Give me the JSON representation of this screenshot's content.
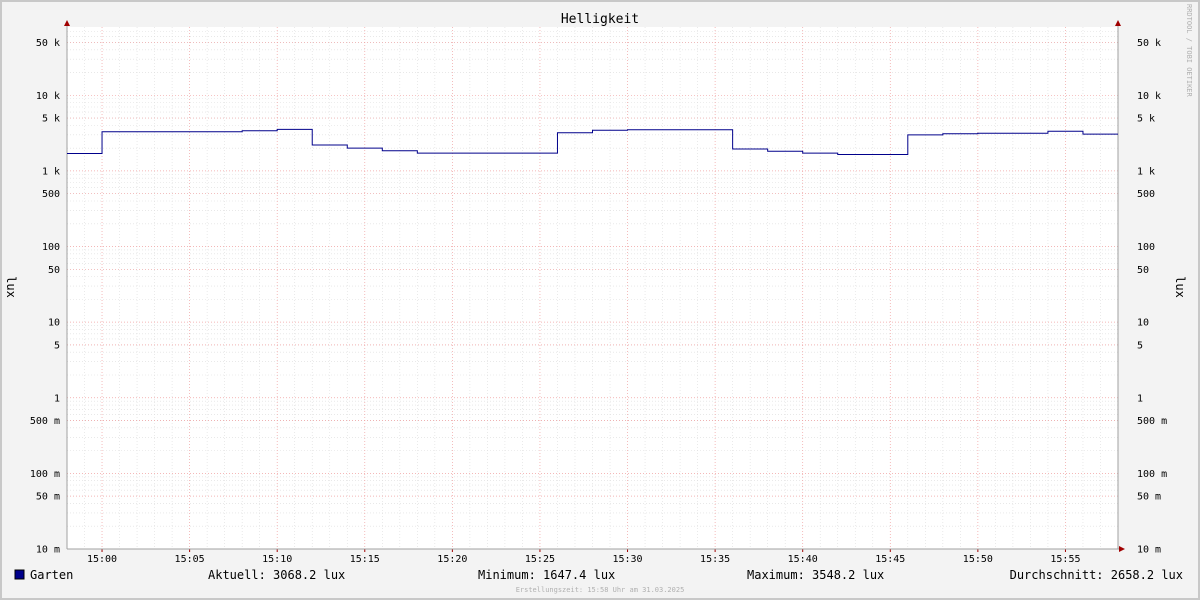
{
  "watermark": "RRDTOOL / TOBI OETIKER",
  "footer": "Erstellungszeit: 15:58 Uhr am 31.03.2025",
  "legend": {
    "series_name": "Garten",
    "current": "Aktuell: 3068.2 lux",
    "minimum": "Minimum: 1647.4 lux",
    "maximum": "Maximum: 3548.2 lux",
    "average": "Durchschnitt: 2658.2 lux"
  },
  "chart_data": {
    "type": "line",
    "title": "Helligkeit",
    "ylabel": "lux",
    "y_scale": "log",
    "ylim": [
      0.01,
      80000
    ],
    "xlim": [
      "14:58",
      "15:58"
    ],
    "grid": true,
    "line_color": "#00008b",
    "legend_color": "#00008b",
    "x_ticks": [
      "15:00",
      "15:05",
      "15:10",
      "15:15",
      "15:20",
      "15:25",
      "15:30",
      "15:35",
      "15:40",
      "15:45",
      "15:50",
      "15:55"
    ],
    "y_ticks": [
      {
        "value": 0.01,
        "label": "10 m"
      },
      {
        "value": 0.05,
        "label": "50 m"
      },
      {
        "value": 0.1,
        "label": "100 m"
      },
      {
        "value": 0.5,
        "label": "500 m"
      },
      {
        "value": 1,
        "label": "1"
      },
      {
        "value": 5,
        "label": "5"
      },
      {
        "value": 10,
        "label": "10"
      },
      {
        "value": 50,
        "label": "50"
      },
      {
        "value": 100,
        "label": "100"
      },
      {
        "value": 500,
        "label": "500"
      },
      {
        "value": 1000,
        "label": "1 k"
      },
      {
        "value": 5000,
        "label": "5 k"
      },
      {
        "value": 10000,
        "label": "10 k"
      },
      {
        "value": 50000,
        "label": "50 k"
      }
    ],
    "series": [
      {
        "name": "Garten",
        "step": true,
        "x": [
          "14:58",
          "15:00",
          "15:08",
          "15:10",
          "15:12",
          "15:14",
          "15:16",
          "15:18",
          "15:26",
          "15:28",
          "15:30",
          "15:36",
          "15:38",
          "15:40",
          "15:42",
          "15:46",
          "15:48",
          "15:50",
          "15:54",
          "15:56",
          "15:58"
        ],
        "values": [
          1700,
          3300,
          3400,
          3548,
          2200,
          2000,
          1850,
          1720,
          3200,
          3450,
          3500,
          1950,
          1820,
          1720,
          1647,
          3000,
          3100,
          3150,
          3350,
          3068,
          3068
        ]
      }
    ]
  }
}
